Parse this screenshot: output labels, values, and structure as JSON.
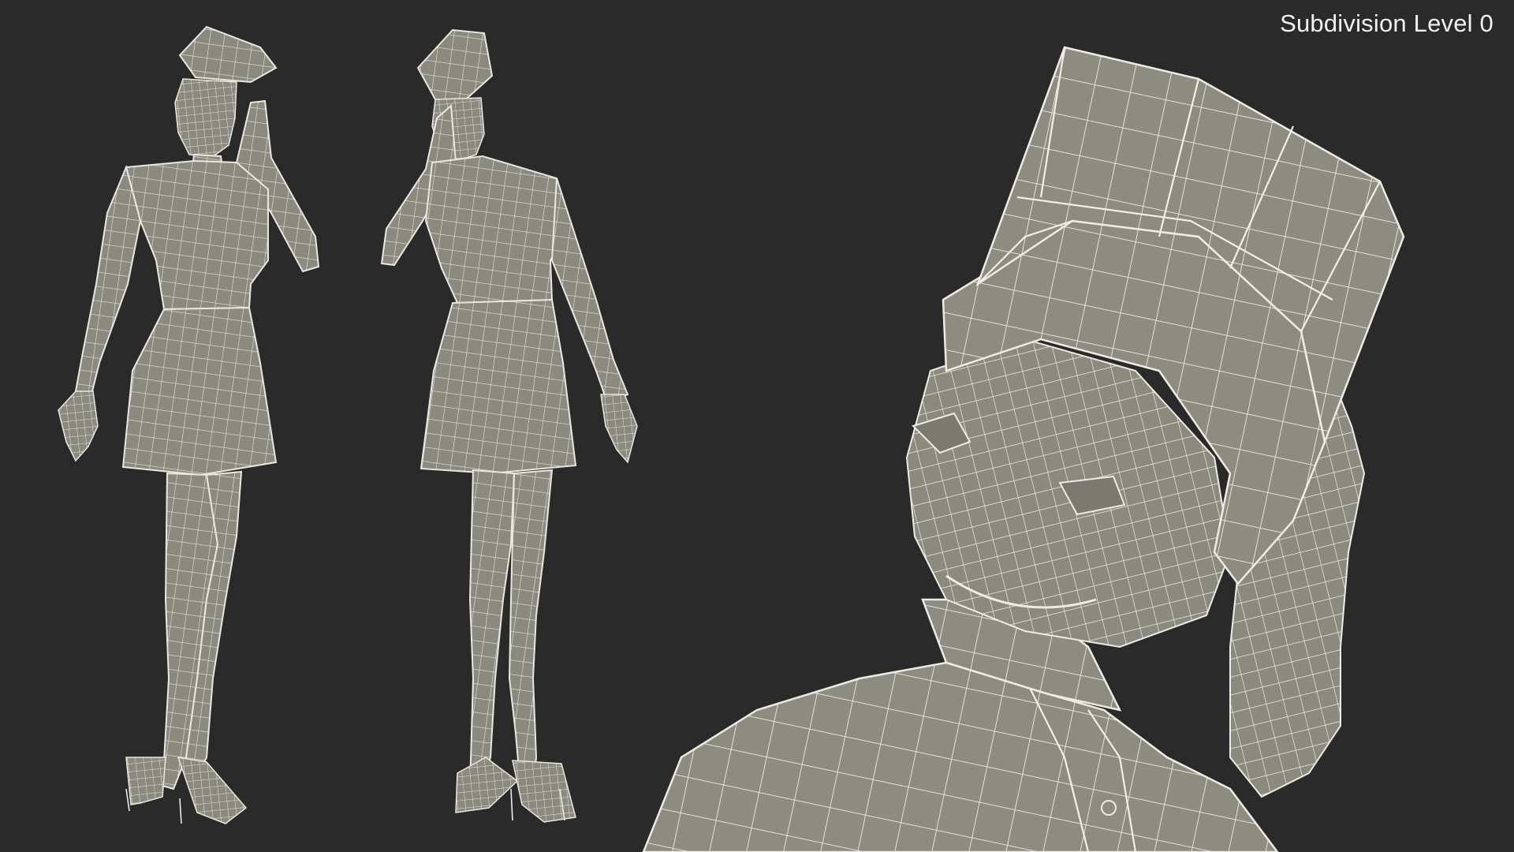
{
  "render": {
    "caption": "Subdivision Level 0",
    "background_color": "#2a2a2a",
    "mesh_color": "#8c8c80",
    "wire_color": "#ecece4"
  },
  "views": [
    {
      "name": "front-view-figure"
    },
    {
      "name": "back-view-figure"
    },
    {
      "name": "head-closeup"
    }
  ]
}
